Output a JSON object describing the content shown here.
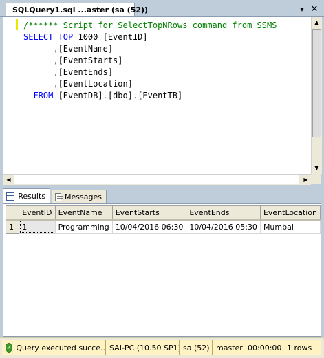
{
  "window": {
    "tab_title": "SQLQuery1.sql ...aster (sa (52))",
    "dropdown_glyph": "▾",
    "close_glyph": "✕"
  },
  "editor": {
    "lines": [
      {
        "parts": [
          {
            "text": "/****** Script for SelectTopNRows command from SSMS",
            "cls": "cm"
          }
        ]
      },
      {
        "parts": [
          {
            "text": "SELECT ",
            "cls": "kw"
          },
          {
            "text": "TOP ",
            "cls": "kw"
          },
          {
            "text": "1000 [EventID]",
            "cls": ""
          }
        ]
      },
      {
        "parts": [
          {
            "text": "      ,",
            "cls": "gy"
          },
          {
            "text": "[EventName]",
            "cls": ""
          }
        ]
      },
      {
        "parts": [
          {
            "text": "      ,",
            "cls": "gy"
          },
          {
            "text": "[EventStarts]",
            "cls": ""
          }
        ]
      },
      {
        "parts": [
          {
            "text": "      ,",
            "cls": "gy"
          },
          {
            "text": "[EventEnds]",
            "cls": ""
          }
        ]
      },
      {
        "parts": [
          {
            "text": "      ,",
            "cls": "gy"
          },
          {
            "text": "[EventLocation]",
            "cls": ""
          }
        ]
      },
      {
        "parts": [
          {
            "text": "  FROM ",
            "cls": "kw"
          },
          {
            "text": "[EventDB]",
            "cls": ""
          },
          {
            "text": ".",
            "cls": "gy"
          },
          {
            "text": "[dbo]",
            "cls": ""
          },
          {
            "text": ".",
            "cls": "gy"
          },
          {
            "text": "[EventTB]",
            "cls": ""
          }
        ]
      }
    ]
  },
  "results_tabs": {
    "results_label": "Results",
    "messages_label": "Messages"
  },
  "grid": {
    "columns": [
      "EventID",
      "EventName",
      "EventStarts",
      "EventEnds",
      "EventLocation"
    ],
    "rows": [
      {
        "rownum": "1",
        "cells": [
          "1",
          "Programming",
          "10/04/2016 06:30",
          "10/04/2016 05:30",
          "Mumbai"
        ]
      }
    ]
  },
  "status": {
    "message": "Query executed succe...",
    "server": "SAI-PC (10.50 SP1)",
    "user": "sa (52)",
    "database": "master",
    "elapsed": "00:00:00",
    "rows": "1 rows"
  },
  "colors": {
    "keyword": "#0000ff",
    "comment": "#008000",
    "operator": "#808080",
    "status_bg": "#fff3c4",
    "ok_icon": "#3c9b2c"
  }
}
